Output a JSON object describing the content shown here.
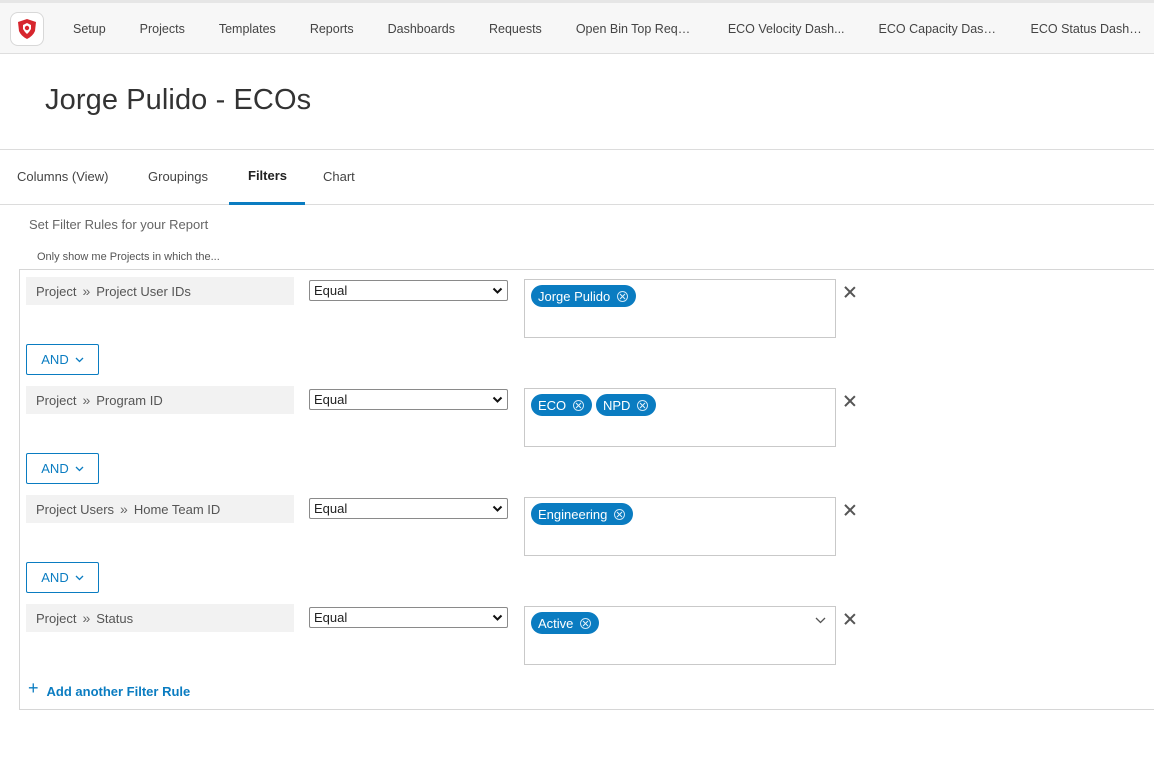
{
  "nav": {
    "items": [
      "Setup",
      "Projects",
      "Templates",
      "Reports",
      "Dashboards",
      "Requests",
      "Open Bin Top Requ...",
      "ECO Velocity Dash...",
      "ECO Capacity Dash...",
      "ECO Status Dashbo..."
    ]
  },
  "page": {
    "title": "Jorge Pulido - ECOs"
  },
  "tabs": [
    "Columns (View)",
    "Groupings",
    "Filters",
    "Chart"
  ],
  "active_tab": "Filters",
  "filters": {
    "subheading": "Set Filter Rules for your Report",
    "hint": "Only show me Projects in which the...",
    "rules": [
      {
        "field_left": "Project",
        "field_right": "Project User IDs",
        "operator": "Equal",
        "values": [
          "Jorge Pulido"
        ]
      },
      {
        "field_left": "Project",
        "field_right": "Program ID",
        "operator": "Equal",
        "values": [
          "ECO",
          "NPD"
        ]
      },
      {
        "field_left": "Project Users",
        "field_right": "Home Team ID",
        "operator": "Equal",
        "values": [
          "Engineering"
        ]
      },
      {
        "field_left": "Project",
        "field_right": "Status",
        "operator": "Equal",
        "values": [
          "Active"
        ]
      }
    ],
    "connector_label": "AND",
    "add_rule_label": "Add another Filter Rule"
  },
  "colors": {
    "accent": "#0a7cc1",
    "chip_text": "#ffffff",
    "logo_red": "#d7262e"
  },
  "icons": {
    "logo": "lion-shield-logo",
    "separator": "double-chevron-right-icon",
    "remove": "close-icon",
    "chip_remove": "circle-x-icon",
    "dropdown": "chevron-down-icon",
    "add": "plus-icon"
  }
}
